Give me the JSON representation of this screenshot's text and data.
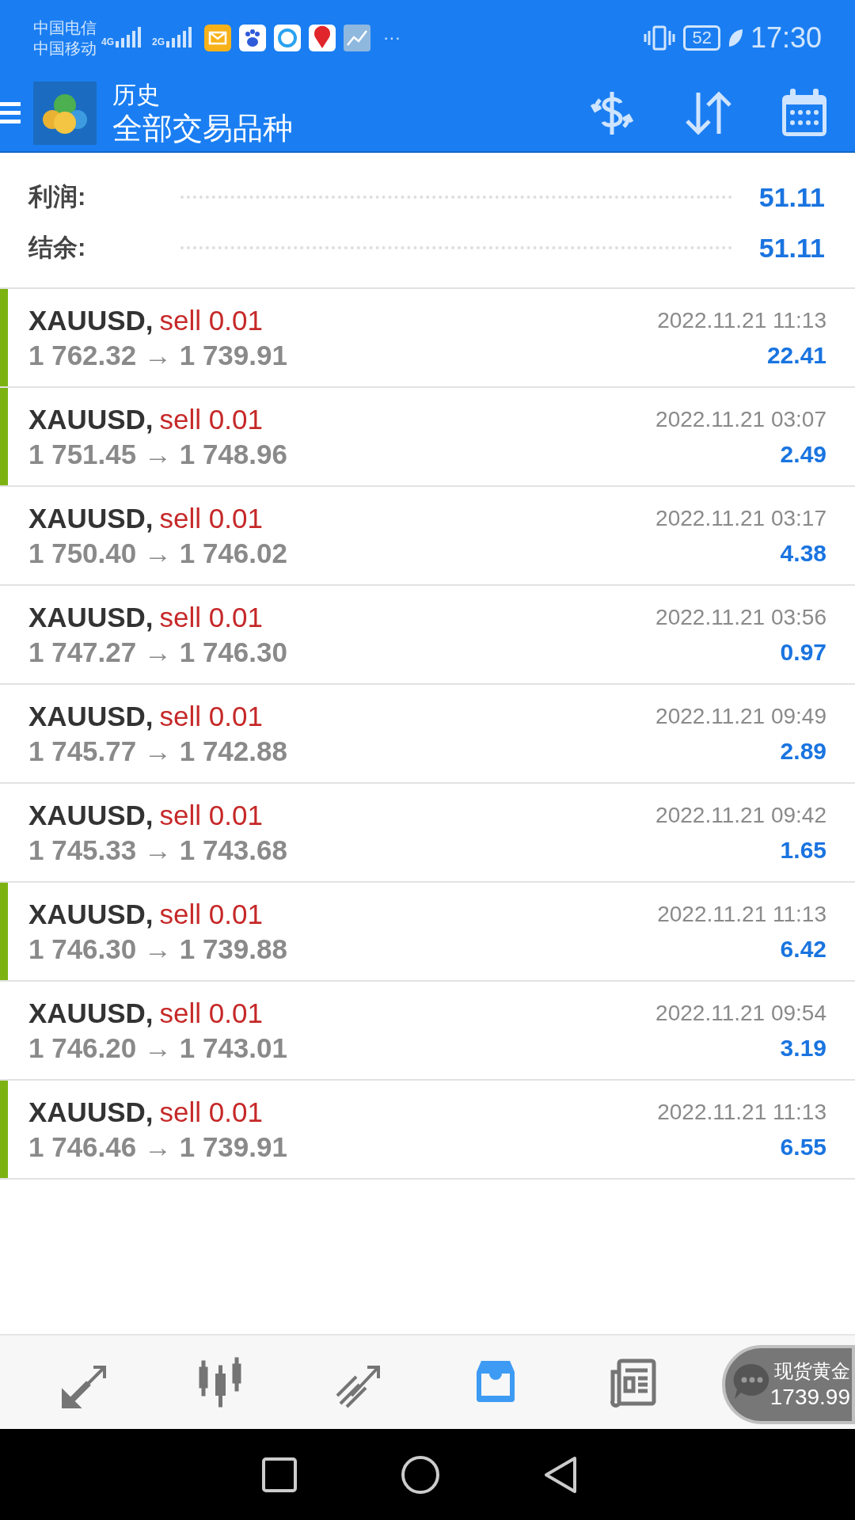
{
  "status_bar": {
    "carriers": [
      "中国电信",
      "中国移动"
    ],
    "networks": [
      "4G",
      "2G"
    ],
    "more": "···",
    "battery": "52",
    "time": "17:30"
  },
  "header": {
    "title": "历史",
    "subtitle": "全部交易品种"
  },
  "summary": [
    {
      "label": "利润:",
      "value": "51.11"
    },
    {
      "label": "结余:",
      "value": "51.11"
    }
  ],
  "deals": [
    {
      "symbol": "XAUUSD,",
      "side": "sell 0.01",
      "prices": "1 762.32 → 1 739.91",
      "time": "2022.11.21 11:13",
      "profit": "22.41",
      "highlighted": true
    },
    {
      "symbol": "XAUUSD,",
      "side": "sell 0.01",
      "prices": "1 751.45 → 1 748.96",
      "time": "2022.11.21 03:07",
      "profit": "2.49",
      "highlighted": true
    },
    {
      "symbol": "XAUUSD,",
      "side": "sell 0.01",
      "prices": "1 750.40 → 1 746.02",
      "time": "2022.11.21 03:17",
      "profit": "4.38",
      "highlighted": false
    },
    {
      "symbol": "XAUUSD,",
      "side": "sell 0.01",
      "prices": "1 747.27 → 1 746.30",
      "time": "2022.11.21 03:56",
      "profit": "0.97",
      "highlighted": false
    },
    {
      "symbol": "XAUUSD,",
      "side": "sell 0.01",
      "prices": "1 745.77 → 1 742.88",
      "time": "2022.11.21 09:49",
      "profit": "2.89",
      "highlighted": false
    },
    {
      "symbol": "XAUUSD,",
      "side": "sell 0.01",
      "prices": "1 745.33 → 1 743.68",
      "time": "2022.11.21 09:42",
      "profit": "1.65",
      "highlighted": false
    },
    {
      "symbol": "XAUUSD,",
      "side": "sell 0.01",
      "prices": "1 746.30 → 1 739.88",
      "time": "2022.11.21 11:13",
      "profit": "6.42",
      "highlighted": true
    },
    {
      "symbol": "XAUUSD,",
      "side": "sell 0.01",
      "prices": "1 746.20 → 1 743.01",
      "time": "2022.11.21 09:54",
      "profit": "3.19",
      "highlighted": false
    },
    {
      "symbol": "XAUUSD,",
      "side": "sell 0.01",
      "prices": "1 746.46 → 1 739.91",
      "time": "2022.11.21 11:13",
      "profit": "6.55",
      "highlighted": true
    }
  ],
  "bottom_nav": [
    {
      "kind": "quotes",
      "selected": false
    },
    {
      "kind": "chart",
      "selected": false
    },
    {
      "kind": "trade",
      "selected": false
    },
    {
      "kind": "history",
      "selected": true
    },
    {
      "kind": "news",
      "selected": false
    }
  ],
  "ticker_widget": {
    "name": "现货黄金",
    "price": "1739.99"
  }
}
